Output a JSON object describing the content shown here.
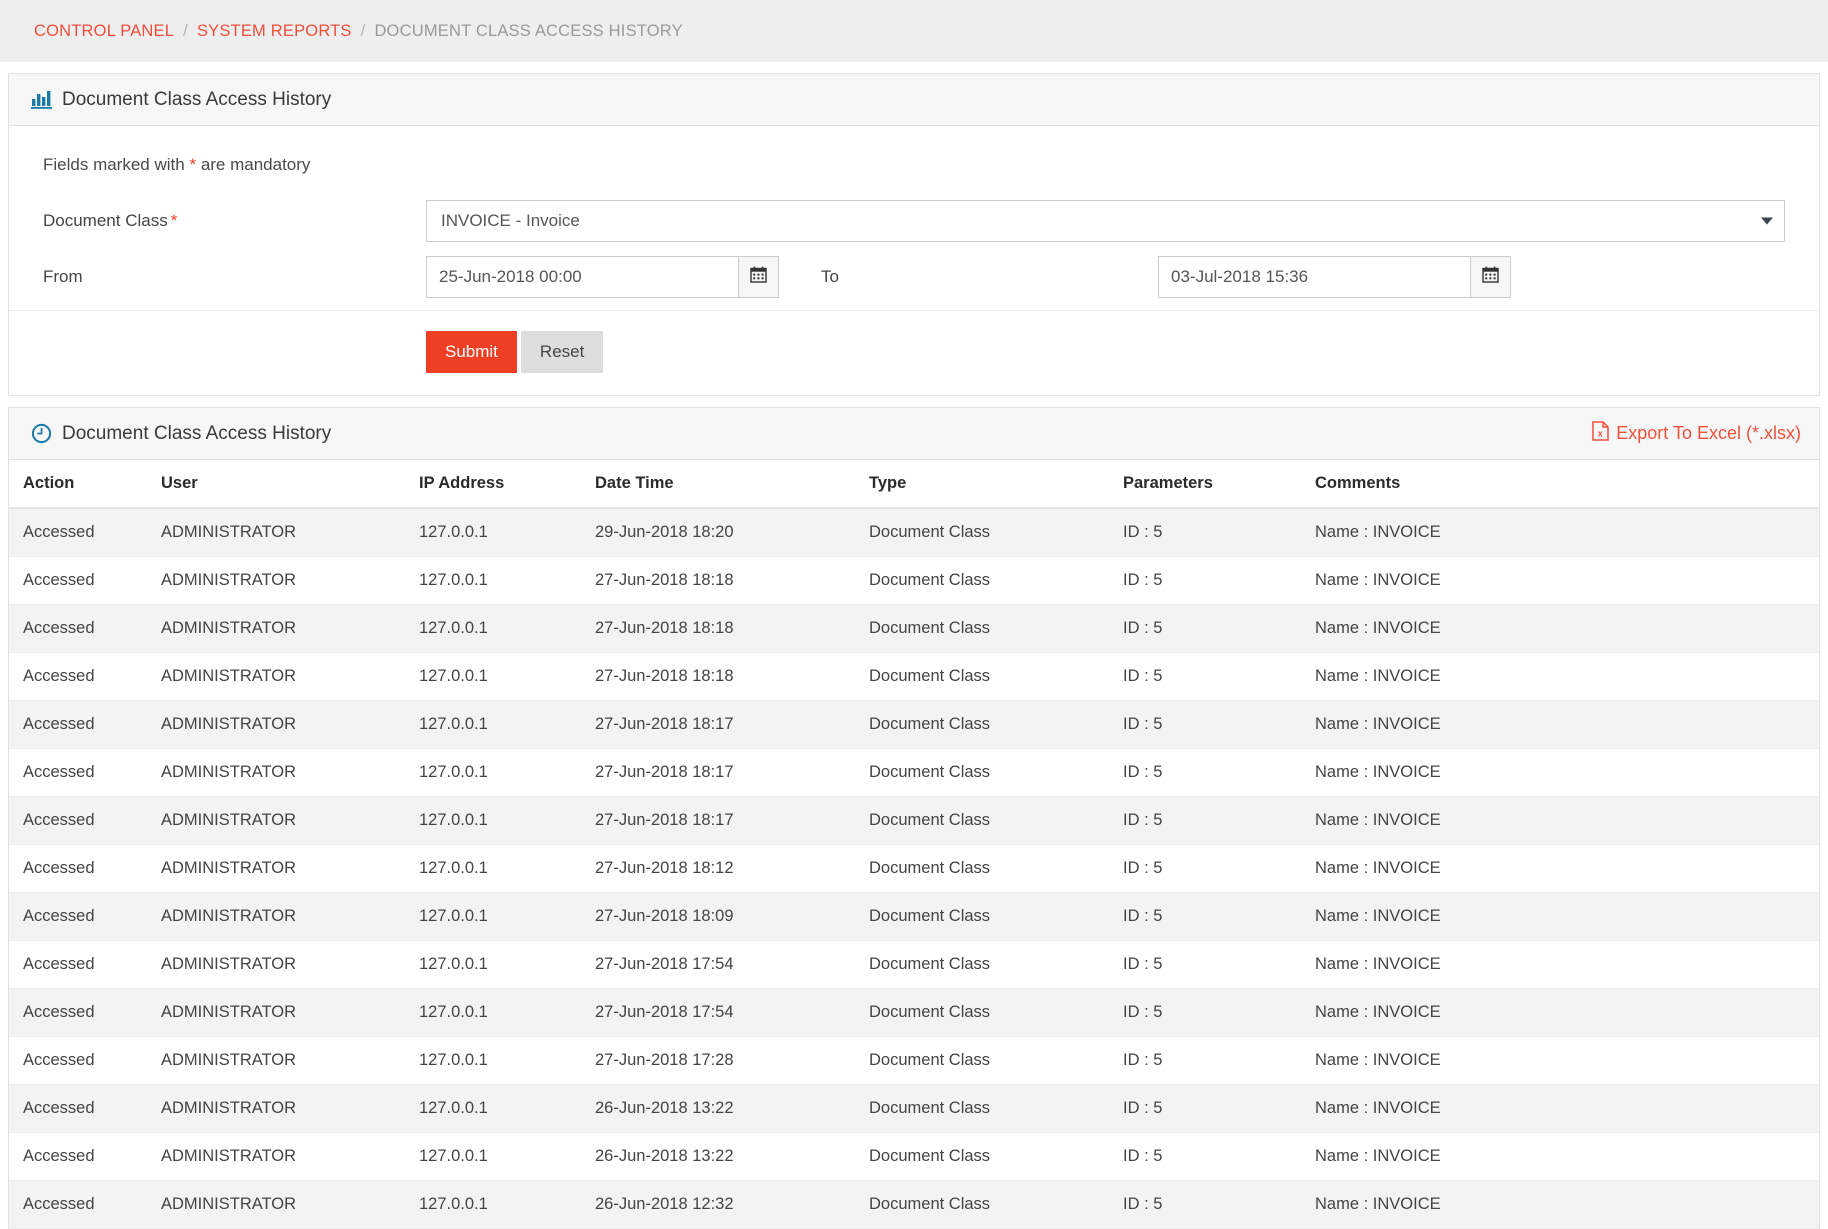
{
  "breadcrumb": {
    "items": [
      {
        "label": "CONTROL PANEL",
        "link": true
      },
      {
        "label": "SYSTEM REPORTS",
        "link": true
      },
      {
        "label": "DOCUMENT CLASS ACCESS HISTORY",
        "link": false
      }
    ],
    "separator": "/"
  },
  "filter_panel": {
    "icon": "bar-chart-icon",
    "title": "Document Class Access History",
    "mandatory_note_prefix": "Fields marked with",
    "mandatory_note_star": "*",
    "mandatory_note_suffix": "are mandatory",
    "document_class": {
      "label": "Document Class",
      "required_star": "*",
      "selected": "INVOICE - Invoice"
    },
    "from": {
      "label": "From",
      "value": "25-Jun-2018 00:00",
      "icon": "calendar-icon"
    },
    "to": {
      "label": "To",
      "value": "03-Jul-2018 15:36",
      "icon": "calendar-icon"
    },
    "submit_label": "Submit",
    "reset_label": "Reset"
  },
  "results_panel": {
    "icon": "clock-icon",
    "title": "Document Class Access History",
    "export_label": "Export To Excel (*.xlsx)",
    "export_icon": "excel-file-icon",
    "columns": [
      "Action",
      "User",
      "IP Address",
      "Date Time",
      "Type",
      "Parameters",
      "Comments"
    ],
    "rows": [
      [
        "Accessed",
        "ADMINISTRATOR",
        "127.0.0.1",
        "29-Jun-2018 18:20",
        "Document Class",
        "ID : 5",
        "Name : INVOICE"
      ],
      [
        "Accessed",
        "ADMINISTRATOR",
        "127.0.0.1",
        "27-Jun-2018 18:18",
        "Document Class",
        "ID : 5",
        "Name : INVOICE"
      ],
      [
        "Accessed",
        "ADMINISTRATOR",
        "127.0.0.1",
        "27-Jun-2018 18:18",
        "Document Class",
        "ID : 5",
        "Name : INVOICE"
      ],
      [
        "Accessed",
        "ADMINISTRATOR",
        "127.0.0.1",
        "27-Jun-2018 18:18",
        "Document Class",
        "ID : 5",
        "Name : INVOICE"
      ],
      [
        "Accessed",
        "ADMINISTRATOR",
        "127.0.0.1",
        "27-Jun-2018 18:17",
        "Document Class",
        "ID : 5",
        "Name : INVOICE"
      ],
      [
        "Accessed",
        "ADMINISTRATOR",
        "127.0.0.1",
        "27-Jun-2018 18:17",
        "Document Class",
        "ID : 5",
        "Name : INVOICE"
      ],
      [
        "Accessed",
        "ADMINISTRATOR",
        "127.0.0.1",
        "27-Jun-2018 18:17",
        "Document Class",
        "ID : 5",
        "Name : INVOICE"
      ],
      [
        "Accessed",
        "ADMINISTRATOR",
        "127.0.0.1",
        "27-Jun-2018 18:12",
        "Document Class",
        "ID : 5",
        "Name : INVOICE"
      ],
      [
        "Accessed",
        "ADMINISTRATOR",
        "127.0.0.1",
        "27-Jun-2018 18:09",
        "Document Class",
        "ID : 5",
        "Name : INVOICE"
      ],
      [
        "Accessed",
        "ADMINISTRATOR",
        "127.0.0.1",
        "27-Jun-2018 17:54",
        "Document Class",
        "ID : 5",
        "Name : INVOICE"
      ],
      [
        "Accessed",
        "ADMINISTRATOR",
        "127.0.0.1",
        "27-Jun-2018 17:54",
        "Document Class",
        "ID : 5",
        "Name : INVOICE"
      ],
      [
        "Accessed",
        "ADMINISTRATOR",
        "127.0.0.1",
        "27-Jun-2018 17:28",
        "Document Class",
        "ID : 5",
        "Name : INVOICE"
      ],
      [
        "Accessed",
        "ADMINISTRATOR",
        "127.0.0.1",
        "26-Jun-2018 13:22",
        "Document Class",
        "ID : 5",
        "Name : INVOICE"
      ],
      [
        "Accessed",
        "ADMINISTRATOR",
        "127.0.0.1",
        "26-Jun-2018 13:22",
        "Document Class",
        "ID : 5",
        "Name : INVOICE"
      ],
      [
        "Accessed",
        "ADMINISTRATOR",
        "127.0.0.1",
        "26-Jun-2018 12:32",
        "Document Class",
        "ID : 5",
        "Name : INVOICE"
      ]
    ]
  },
  "colors": {
    "accent_red": "#ee3f24",
    "link_red": "#ef4e3a",
    "icon_blue": "#1a7aa8",
    "breadcrumb_bg": "#eeeeee"
  }
}
